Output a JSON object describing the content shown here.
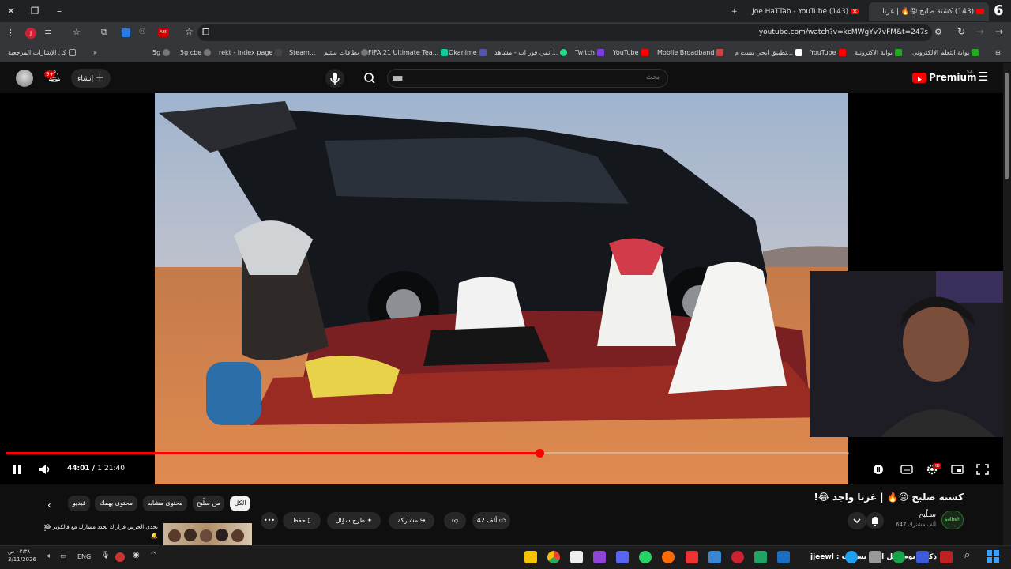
{
  "browser": {
    "tabs": [
      {
        "title": "(143) كشتة صلبح 😜🔥 | غزنا",
        "active": true
      },
      {
        "title": "(143) Joe HaTTab - YouTube",
        "active": false
      }
    ],
    "tab_count_badge": "6",
    "url": "youtube.com/watch?v=kcMWgYv7vFM&t=247s",
    "bookmarks_all": "كل الإشارات المرجعية",
    "bookmarks": [
      "5g",
      "5g cbe",
      "rekt - Index page",
      "Steam...",
      "بطاقات ستيم",
      "FIFA 21 Ultimate Tea...",
      "Okanime",
      "انمي فور اب - مشاهد...",
      "Twitch",
      "YouTube",
      "Mobile Broadband",
      "تطبيق ايجي بست م...",
      "YouTube",
      "بوابة الاكترونية",
      "بوابة التعلم الالكتروني"
    ],
    "ext_abp": "ABP"
  },
  "youtube": {
    "notifications_badge": "9+",
    "create_label": "إنشاء",
    "search_placeholder": "بحث",
    "search_value": "▅▅",
    "premium_label": "Premium",
    "premium_region": "SA"
  },
  "player": {
    "time_current": "44:01",
    "time_total": "1:21:40",
    "progress_fraction": 0.633,
    "settings_badge": "HD"
  },
  "video": {
    "title": "كشتة صلبح 😜🔥 | غزنا واجد 😂!",
    "channel_name": "سـلّبح",
    "subscribers": "647 ألف مشترك",
    "channel_avatar_text": "salbeh",
    "likes": "42 ألف",
    "share_label": "مشاركة",
    "ask_label": "طرح سؤال",
    "save_label": "حفظ",
    "more_label": "•••"
  },
  "chips": [
    "الكل",
    "من سلّبح",
    "محتوى مشابه",
    "محتوى يهمك",
    "فيديو"
  ],
  "recommendation": {
    "title": "تحدي الجرس فراراك بحدد مسارك مع فالكونز 😂🔔"
  },
  "taskbar": {
    "time": "٠٣:٣٨ ص",
    "date": "3/11/2026",
    "lang": "ENG",
    "ticker": "ذكرنه يوم قبل التي بسست : jjeewl"
  },
  "colors": {
    "accent": "#ff0000",
    "background": "#0f0f0f",
    "chip": "#272727"
  }
}
